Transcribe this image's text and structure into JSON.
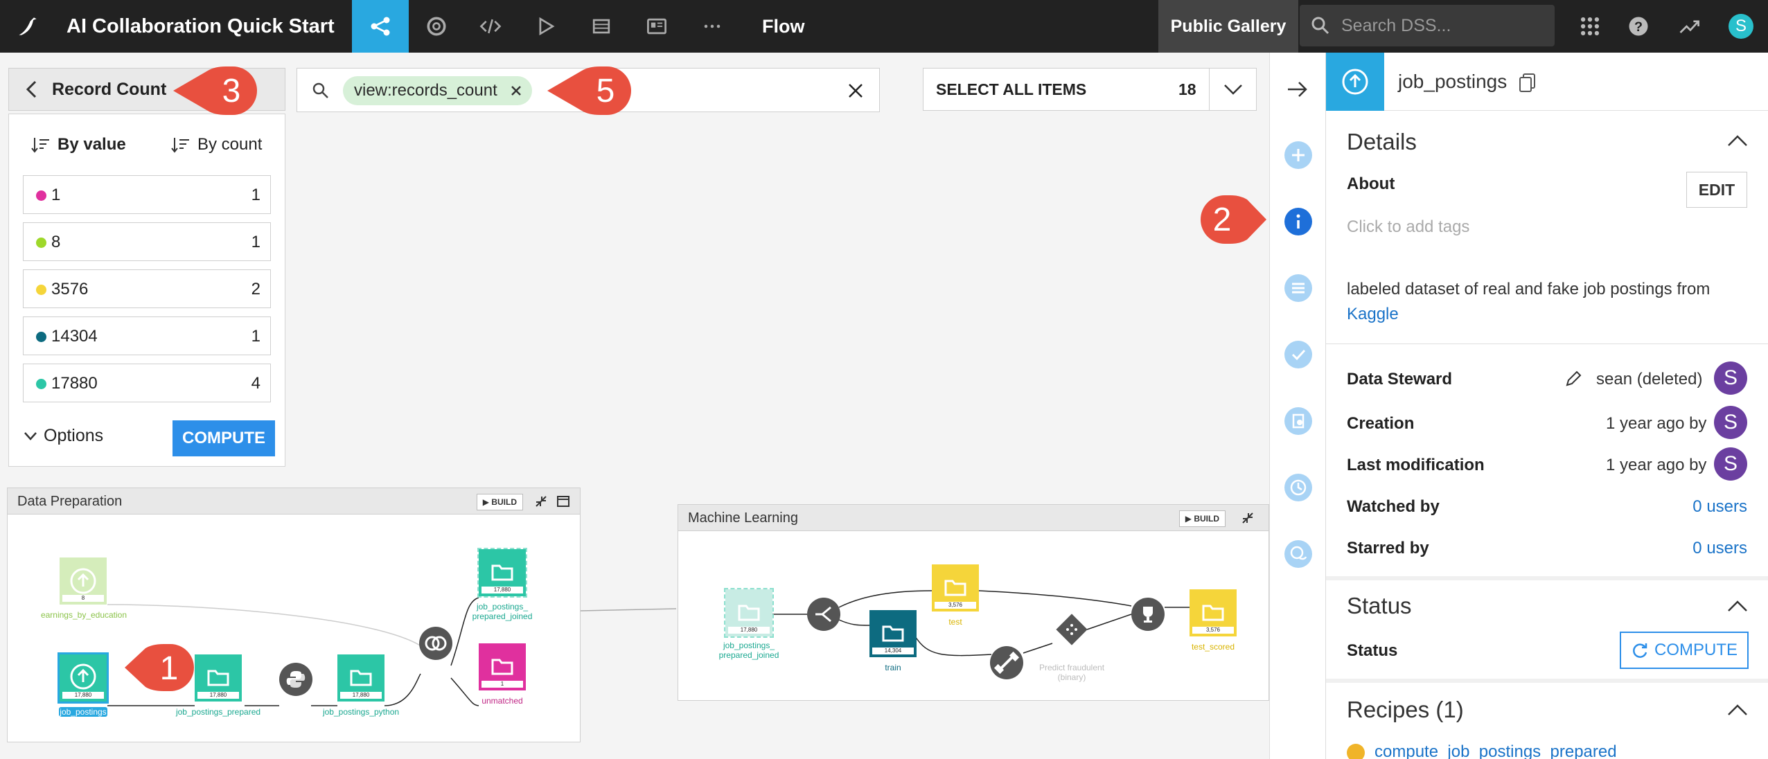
{
  "topbar": {
    "title": "AI Collaboration Quick Start",
    "flow_label": "Flow",
    "public_gallery": "Public Gallery",
    "search_placeholder": "Search DSS...",
    "avatar_letter": "S"
  },
  "record_panel": {
    "title": "Record Count",
    "sort_by_value": "By value",
    "sort_by_count": "By count",
    "rows": [
      {
        "value": "1",
        "count": "1",
        "color": "#e0309e"
      },
      {
        "value": "8",
        "count": "1",
        "color": "#9ed82a"
      },
      {
        "value": "3576",
        "count": "2",
        "color": "#f5d53a"
      },
      {
        "value": "14304",
        "count": "1",
        "color": "#0d6b80"
      },
      {
        "value": "17880",
        "count": "4",
        "color": "#2cc6a6"
      }
    ],
    "options_label": "Options",
    "compute_label": "COMPUTE"
  },
  "filter": {
    "chip": "view:records_count"
  },
  "select_all": {
    "label": "SELECT ALL ITEMS",
    "count": "18"
  },
  "zones": {
    "prep": {
      "title": "Data Preparation",
      "build": "BUILD",
      "nodes": {
        "earnings": "earnings_by_education",
        "earnings_count": "8",
        "job_postings": "job_postings",
        "job_postings_count": "17,880",
        "prepared": "job_postings_prepared",
        "prepared_count": "17,880",
        "python": "job_postings_python",
        "python_count": "17,880",
        "joined_1": "job_postings_",
        "joined_2": "prepared_joined",
        "joined_count": "17,880",
        "unmatched": "unmatched",
        "unmatched_count": "1"
      }
    },
    "ml": {
      "title": "Machine Learning",
      "build": "BUILD",
      "nodes": {
        "joined_1": "job_postings_",
        "joined_2": "prepared_joined",
        "joined_count": "17,880",
        "test": "test",
        "test_count": "3,576",
        "train": "train",
        "train_count": "14,304",
        "predict_1": "Predict fraudulent",
        "predict_2": "(binary)",
        "test_scored": "test_scored",
        "test_scored_count": "3,576"
      }
    }
  },
  "right_panel": {
    "dataset_name": "job_postings",
    "details_title": "Details",
    "about_label": "About",
    "edit_label": "EDIT",
    "tags_placeholder": "Click to add tags",
    "description_1": "labeled dataset of real and fake job postings from",
    "description_link": "Kaggle",
    "data_steward_label": "Data Steward",
    "data_steward_value": "sean (deleted)",
    "creation_label": "Creation",
    "creation_value": "1 year ago by",
    "last_mod_label": "Last modification",
    "last_mod_value": "1 year ago by",
    "watched_label": "Watched by",
    "watched_value": "0 users",
    "starred_label": "Starred by",
    "starred_value": "0 users",
    "status_title": "Status",
    "status_label": "Status",
    "status_compute": "COMPUTE",
    "recipes_title": "Recipes (1)",
    "recipe_item": "compute_job_postings_prepared",
    "avatar_letter": "S"
  },
  "callouts": {
    "one": "1",
    "two": "2",
    "three": "3",
    "five": "5"
  },
  "colors": {
    "accent_blue": "#29a8e0",
    "callout_red": "#e8503f",
    "teal": "#2cc6a6",
    "yellow": "#f5d53a",
    "magenta": "#e0309e"
  }
}
